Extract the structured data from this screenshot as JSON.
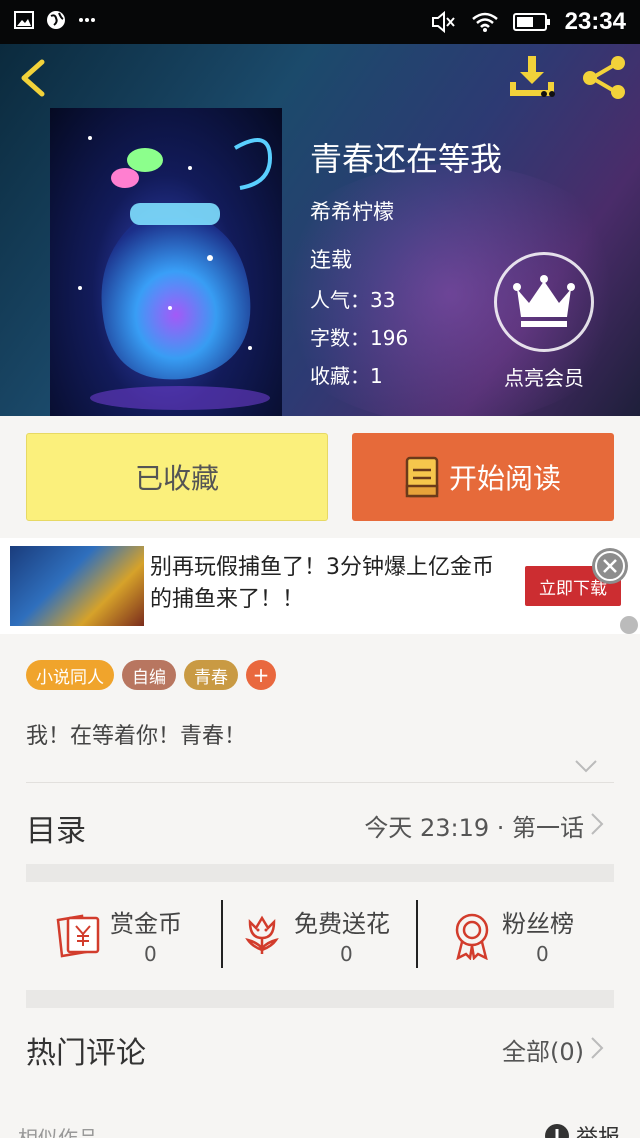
{
  "status_bar": {
    "time": "23:34"
  },
  "book": {
    "title": "青春还在等我",
    "author": "希希柠檬",
    "status": "连载",
    "popularity_label": "人气：",
    "popularity": "33",
    "words_label": "字数：",
    "words": "196",
    "favorites_label": "收藏：",
    "favorites": "1"
  },
  "vip": {
    "label": "点亮会员"
  },
  "actions": {
    "collect_label": "已收藏",
    "read_label": "开始阅读"
  },
  "ad": {
    "text": "别再玩假捕鱼了！3分钟爆上亿金币的捕鱼来了！！",
    "cta": "立即下载"
  },
  "tags": [
    {
      "label": "小说同人",
      "color": "#f0a42c"
    },
    {
      "label": "自编",
      "color": "#b87660"
    },
    {
      "label": "青春",
      "color": "#c99a43"
    }
  ],
  "tag_add": "+",
  "description": "我！在等着你！青春！",
  "catalog": {
    "label": "目录",
    "latest": "今天 23:19 · 第一话"
  },
  "stats": [
    {
      "title": "赏金币",
      "value": "0",
      "icon": "reward-coin-icon"
    },
    {
      "title": "免费送花",
      "value": "0",
      "icon": "flower-icon"
    },
    {
      "title": "粉丝榜",
      "value": "0",
      "icon": "medal-icon"
    }
  ],
  "comments": {
    "label": "热门评论",
    "all": "全部(0)"
  },
  "footer": {
    "similar": "相似作品",
    "report": "举报"
  },
  "colors": {
    "accent_orange": "#e66a3a",
    "collect_yellow": "#fbf07c",
    "icon_red": "#d23c2c",
    "header_icon_yellow": "#f2d23a"
  }
}
